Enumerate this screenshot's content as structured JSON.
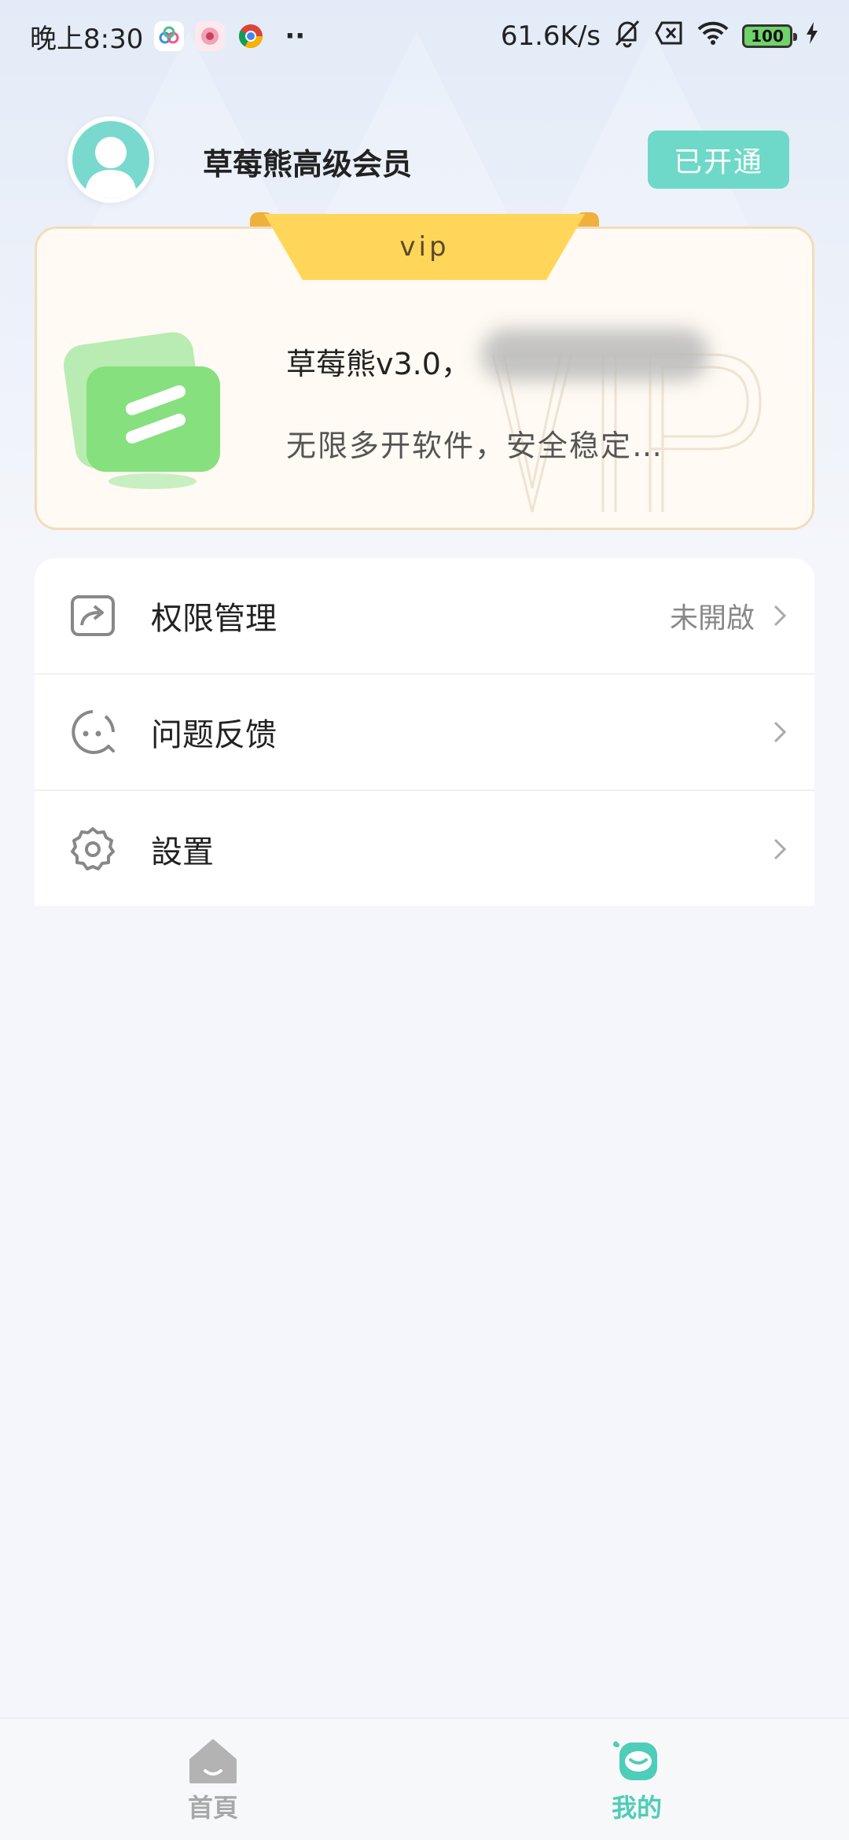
{
  "status_bar": {
    "time": "晚上8:30",
    "overflow_dots": "··",
    "net_speed": "61.6K/s",
    "battery_level": "100"
  },
  "header": {
    "member_title": "草莓熊高级会员",
    "opened_label": "已开通"
  },
  "vip_card": {
    "ribbon_label": "vip",
    "app_name_version": "草莓熊v3.0，",
    "description": "无限多开软件，安全稳定…",
    "watermark_text": "VIP"
  },
  "menu": {
    "items": [
      {
        "label": "权限管理",
        "status": "未開啟",
        "icon": "permission-share-icon"
      },
      {
        "label": "问题反馈",
        "status": "",
        "icon": "feedback-face-icon"
      },
      {
        "label": "設置",
        "status": "",
        "icon": "gear-icon"
      }
    ]
  },
  "bottom_nav": {
    "items": [
      {
        "label": "首頁",
        "icon": "home-icon",
        "active": false
      },
      {
        "label": "我的",
        "icon": "mine-face-icon",
        "active": true
      }
    ]
  },
  "colors": {
    "accent_teal": "#6ed9c8",
    "active_nav": "#4ecdb8",
    "inactive_nav": "#a8a8a8",
    "ribbon_yellow": "#ffd65a",
    "card_border": "#f3dcbb",
    "app_icon_green": "#86e07e"
  }
}
